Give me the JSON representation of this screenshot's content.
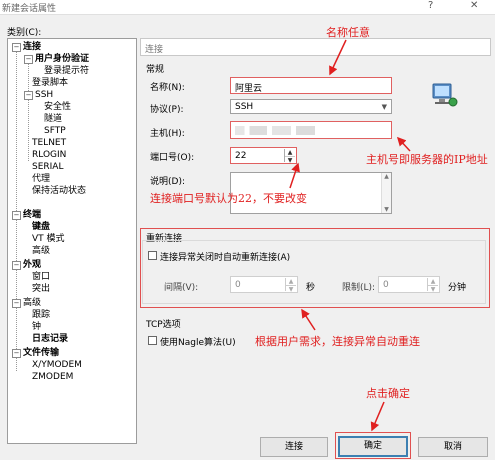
{
  "window": {
    "title": "新建会话属性",
    "help": "?",
    "close": "✕"
  },
  "category_label": "类别(C):",
  "tree": {
    "connection": "连接",
    "user_auth": "用户身份验证",
    "login_prompt": "登录提示符",
    "login_script": "登录脚本",
    "ssh": "SSH",
    "security": "安全性",
    "tunnel": "隧道",
    "sftp": "SFTP",
    "telnet": "TELNET",
    "rlogin": "RLOGIN",
    "serial": "SERIAL",
    "proxy": "代理",
    "keepalive": "保持活动状态",
    "terminal": "终端",
    "keyboard": "键盘",
    "vt_mode": "VT 模式",
    "advanced1": "高级",
    "appearance": "外观",
    "window_item": "窗口",
    "highlight": "突出",
    "advanced2": "高级",
    "trace": "跟踪",
    "bell": "钟",
    "logging": "日志记录",
    "file_transfer": "文件传输",
    "xymodem": "X/YMODEM",
    "zmodem": "ZMODEM"
  },
  "panel_header": "连接",
  "general": {
    "group": "常规",
    "name_label": "名称(N):",
    "name_value": "阿里云",
    "protocol_label": "协议(P):",
    "protocol_value": "SSH",
    "host_label": "主机(H):",
    "host_value": "",
    "port_label": "端口号(O):",
    "port_value": "22",
    "desc_label": "说明(D):",
    "desc_value": ""
  },
  "reconnect": {
    "group": "重新连接",
    "auto_label": "连接异常关闭时自动重新连接(A)",
    "interval_label": "间隔(V):",
    "interval_value": "0",
    "seconds": "秒",
    "limit_label": "限制(L):",
    "limit_value": "0",
    "minutes": "分钟"
  },
  "tcp": {
    "group": "TCP选项",
    "nagle_label": "使用Nagle算法(U)"
  },
  "buttons": {
    "connect": "连接",
    "ok": "确定",
    "cancel": "取消"
  },
  "annotations": {
    "name": "名称任意",
    "host": "主机号即服务器的IP地址",
    "port": "连接端口号默认为22，不要改变",
    "reconnect": "根据用户需求，连接异常自动重连",
    "ok": "点击确定"
  },
  "colors": {
    "annotation": "#e02020",
    "focus": "#3c7fb1"
  }
}
